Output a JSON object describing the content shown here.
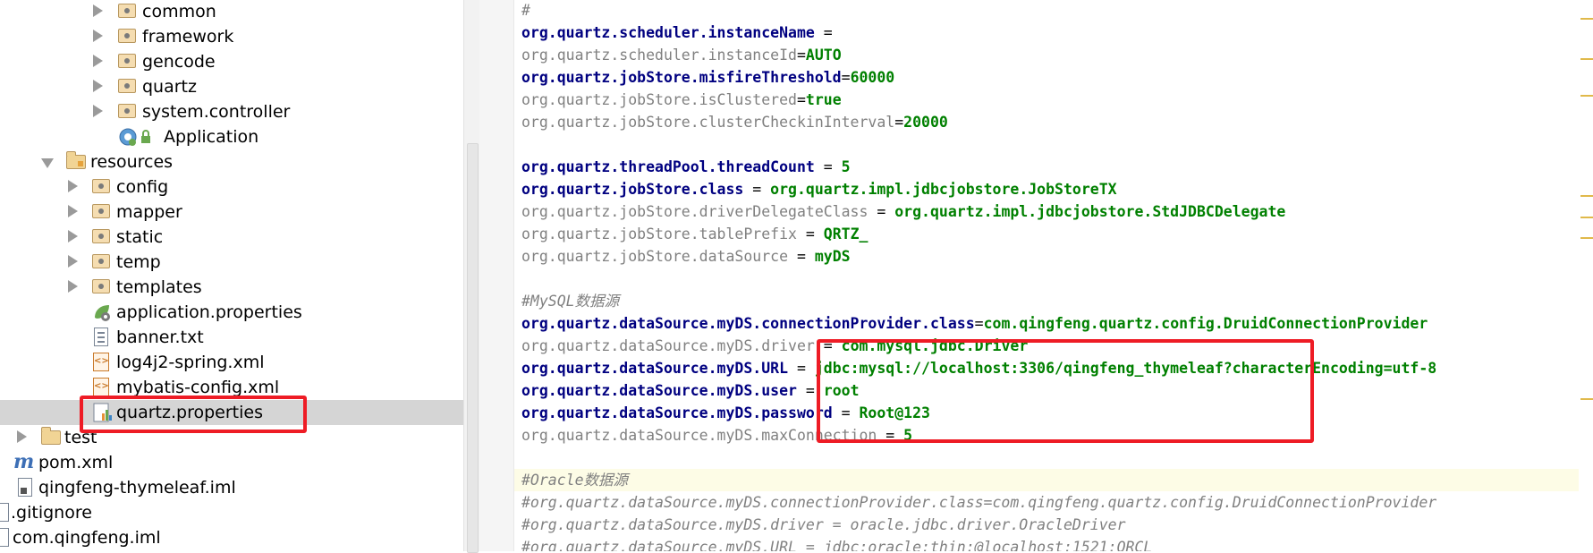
{
  "project_tree": {
    "items": [
      {
        "label": "common",
        "kind": "package",
        "expandable": true
      },
      {
        "label": "framework",
        "kind": "package",
        "expandable": true
      },
      {
        "label": "gencode",
        "kind": "package",
        "expandable": true
      },
      {
        "label": "quartz",
        "kind": "package",
        "expandable": true
      },
      {
        "label": "system.controller",
        "kind": "package",
        "expandable": true
      },
      {
        "label": "Application",
        "kind": "spring-boot-class",
        "expandable": false
      },
      {
        "label": "resources",
        "kind": "resources-folder",
        "expandable": true,
        "expanded": true
      },
      {
        "label": "config",
        "kind": "package",
        "expandable": true
      },
      {
        "label": "mapper",
        "kind": "package",
        "expandable": true
      },
      {
        "label": "static",
        "kind": "package",
        "expandable": true
      },
      {
        "label": "temp",
        "kind": "package",
        "expandable": true
      },
      {
        "label": "templates",
        "kind": "package",
        "expandable": true
      },
      {
        "label": "application.properties",
        "kind": "spring-properties",
        "expandable": false
      },
      {
        "label": "banner.txt",
        "kind": "text-file",
        "expandable": false
      },
      {
        "label": "log4j2-spring.xml",
        "kind": "xml-file",
        "expandable": false
      },
      {
        "label": "mybatis-config.xml",
        "kind": "xml-file",
        "expandable": false
      },
      {
        "label": "quartz.properties",
        "kind": "properties-file",
        "expandable": false,
        "selected": true,
        "highlighted": true
      },
      {
        "label": "test",
        "kind": "folder",
        "expandable": true
      },
      {
        "label": "pom.xml",
        "kind": "maven-file",
        "expandable": false
      },
      {
        "label": "qingfeng-thymeleaf.iml",
        "kind": "iml-file",
        "expandable": false
      },
      {
        "label": ".gitignore",
        "kind": "text-file",
        "expandable": false
      },
      {
        "label": "com.qingfeng.iml",
        "kind": "iml-file",
        "expandable": false
      }
    ]
  },
  "editor": {
    "lines": [
      {
        "text": "#",
        "type": "comment"
      },
      {
        "key": "org.quartz.scheduler.instanceName",
        "sep": " = ",
        "value": "",
        "weight": "bold"
      },
      {
        "key": "org.quartz.scheduler.instanceId",
        "sep": "=",
        "value": "AUTO",
        "weight": "grey"
      },
      {
        "key": "org.quartz.jobStore.misfireThreshold",
        "sep": "=",
        "value": "60000",
        "weight": "bold"
      },
      {
        "key": "org.quartz.jobStore.isClustered",
        "sep": "=",
        "value": "true",
        "weight": "grey"
      },
      {
        "key": "org.quartz.jobStore.clusterCheckinInterval",
        "sep": "=",
        "value": "20000",
        "weight": "grey"
      },
      {
        "text": "",
        "type": "blank"
      },
      {
        "key": "org.quartz.threadPool.threadCount",
        "sep": " = ",
        "value": "5",
        "weight": "bold"
      },
      {
        "key": "org.quartz.jobStore.class",
        "sep": " = ",
        "value": "org.quartz.impl.jdbcjobstore.JobStoreTX",
        "weight": "bold"
      },
      {
        "key": "org.quartz.jobStore.driverDelegateClass",
        "sep": " = ",
        "value": "org.quartz.impl.jdbcjobstore.StdJDBCDelegate",
        "weight": "grey"
      },
      {
        "key": "org.quartz.jobStore.tablePrefix",
        "sep": " = ",
        "value": "QRTZ_",
        "weight": "grey"
      },
      {
        "key": "org.quartz.jobStore.dataSource",
        "sep": " = ",
        "value": "myDS",
        "weight": "grey"
      },
      {
        "text": "",
        "type": "blank"
      },
      {
        "text": "#MySQL数据源",
        "type": "comment"
      },
      {
        "key": "org.quartz.dataSource.myDS.connectionProvider.class",
        "sep": "=",
        "value": "com.qingfeng.quartz.config.DruidConnectionProvider",
        "weight": "bold"
      },
      {
        "key": "org.quartz.dataSource.myDS.driver",
        "sep": " = ",
        "value": "com.mysql.jdbc.Driver",
        "weight": "grey"
      },
      {
        "key": "org.quartz.dataSource.myDS.URL",
        "sep": " = ",
        "value": "jdbc:mysql://localhost:3306/qingfeng_thymeleaf?characterEncoding=utf-8",
        "weight": "bold"
      },
      {
        "key": "org.quartz.dataSource.myDS.user",
        "sep": " = ",
        "value": "root",
        "weight": "bold"
      },
      {
        "key": "org.quartz.dataSource.myDS.password",
        "sep": " = ",
        "value": "Root@123",
        "weight": "bold"
      },
      {
        "key": "org.quartz.dataSource.myDS.maxConnection",
        "sep": " = ",
        "value": "5",
        "weight": "grey"
      },
      {
        "text": "",
        "type": "blank"
      },
      {
        "text": "#Oracle数据源",
        "type": "comment",
        "highlight": true
      },
      {
        "text": "#org.quartz.dataSource.myDS.connectionProvider.class=com.qingfeng.quartz.config.DruidConnectionProvider",
        "type": "comment"
      },
      {
        "text": "#org.quartz.dataSource.myDS.driver = oracle.jdbc.driver.OracleDriver",
        "type": "comment"
      },
      {
        "text": "#org.quartz.dataSource.myDS.URL = jdbc:oracle:thin:@localhost:1521:ORCL",
        "type": "comment"
      }
    ]
  },
  "colors": {
    "key_bold": "#000080",
    "key_grey": "#808080",
    "value": "#008000",
    "comment": "#808080",
    "annotation_red": "#ee1c25",
    "selection": "#d5d5d5"
  }
}
